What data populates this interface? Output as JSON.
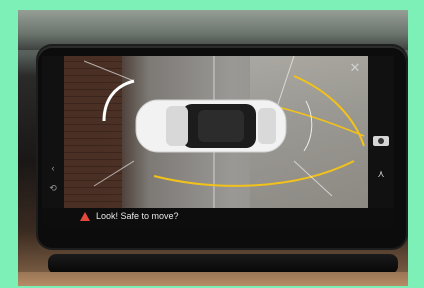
{
  "notice": {
    "text": "Look! Safe to move?",
    "icon": "warning-triangle-icon",
    "color": "#e24a3c"
  },
  "controls": {
    "close_icon": "close-icon",
    "camera_icon": "camera-icon",
    "view_icon": "view-toggle-icon",
    "left_icons": [
      "chevron-left-icon",
      "parking-mode-icon"
    ]
  },
  "guide_colors": {
    "side_arc": "#f2c21b",
    "lateral": "#f2c21b",
    "rear_arc": "#ffffff"
  }
}
